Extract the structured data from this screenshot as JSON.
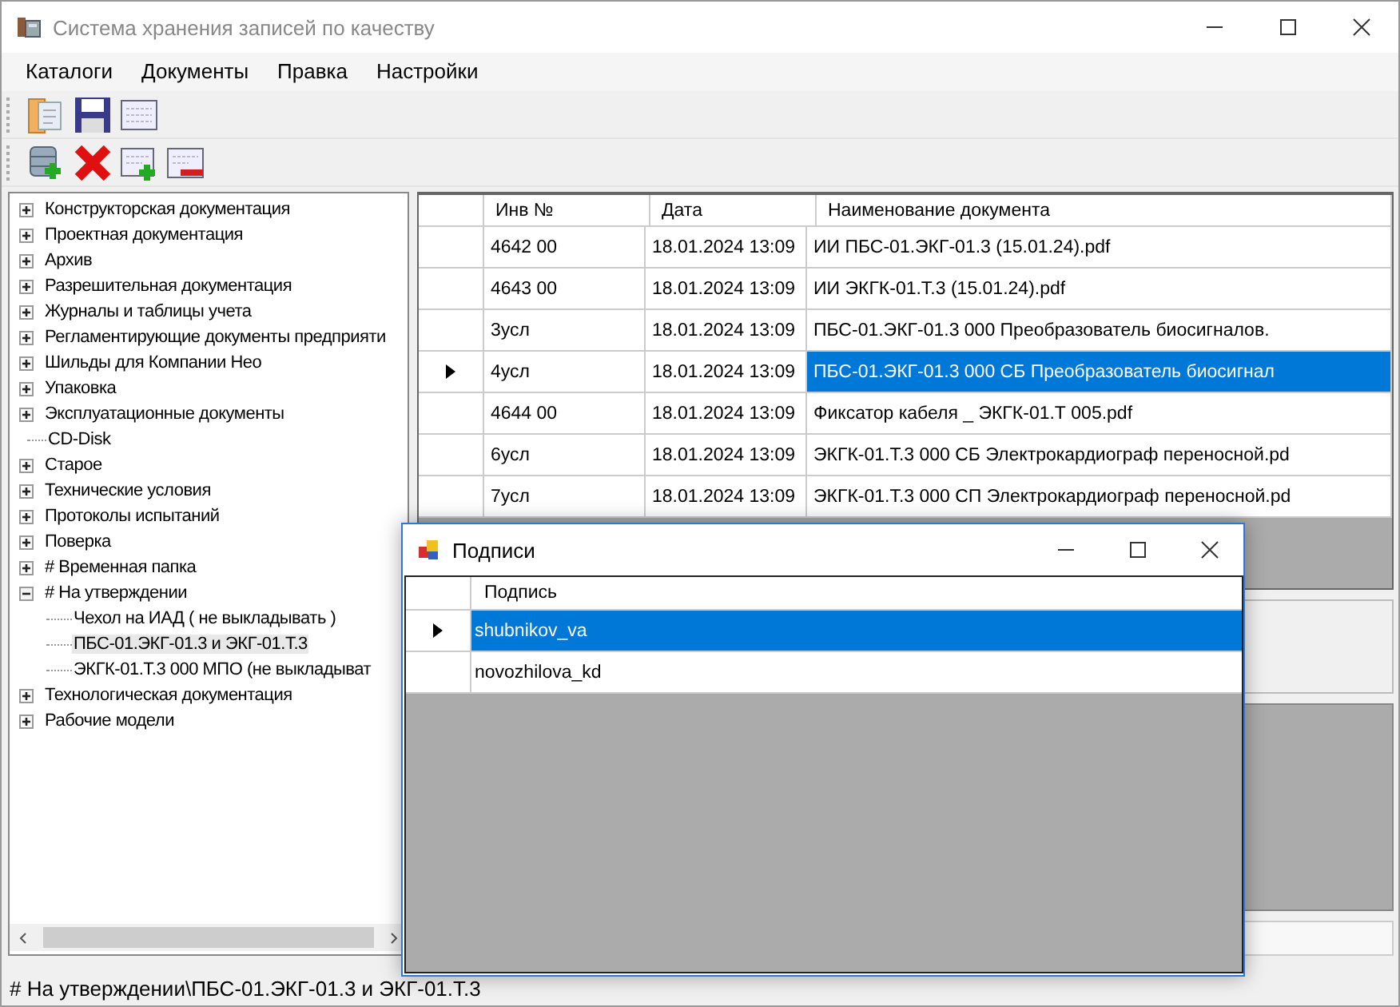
{
  "window": {
    "title": "Система хранения записей по качеству"
  },
  "menu": [
    "Каталоги",
    "Документы",
    "Правка",
    "Настройки"
  ],
  "tree": [
    {
      "label": "Конструкторская документация",
      "has_children": true,
      "expanded": false,
      "selected": false
    },
    {
      "label": "Проектная документация",
      "has_children": true,
      "expanded": false,
      "selected": false
    },
    {
      "label": "Архив",
      "has_children": true,
      "expanded": false,
      "selected": false
    },
    {
      "label": "Разрешительная документация",
      "has_children": true,
      "expanded": false,
      "selected": false
    },
    {
      "label": "Журналы и таблицы учета",
      "has_children": true,
      "expanded": false,
      "selected": false
    },
    {
      "label": "Регламентирующие документы предприяти",
      "has_children": true,
      "expanded": false,
      "selected": false
    },
    {
      "label": "Шильды для Компании Нео",
      "has_children": true,
      "expanded": false,
      "selected": false
    },
    {
      "label": "Упаковка",
      "has_children": true,
      "expanded": false,
      "selected": false
    },
    {
      "label": "Эксплуатационные документы",
      "has_children": true,
      "expanded": false,
      "selected": false
    },
    {
      "label": "CD-Disk",
      "has_children": false,
      "selected": false
    },
    {
      "label": "Старое",
      "has_children": true,
      "expanded": false,
      "selected": false
    },
    {
      "label": "Технические условия",
      "has_children": true,
      "expanded": false,
      "selected": false
    },
    {
      "label": "Протоколы испытаний",
      "has_children": true,
      "expanded": false,
      "selected": false
    },
    {
      "label": "Поверка",
      "has_children": true,
      "expanded": false,
      "selected": false
    },
    {
      "label": "# Временная папка",
      "has_children": true,
      "expanded": false,
      "selected": false
    },
    {
      "label": "# На утверждении",
      "has_children": true,
      "expanded": true,
      "selected": false,
      "children": [
        {
          "label": "Чехол на ИАД ( не выкладывать )",
          "has_children": false,
          "selected": false
        },
        {
          "label": "ПБС-01.ЭКГ-01.3  и ЭКГ-01.Т.3",
          "has_children": false,
          "selected": true
        },
        {
          "label": "ЭКГК-01.Т.3 000 МПО (не выкладыват",
          "has_children": false,
          "selected": false
        }
      ]
    },
    {
      "label": "Технологическая документация",
      "has_children": true,
      "expanded": false,
      "selected": false
    },
    {
      "label": "Рабочие модели",
      "has_children": true,
      "expanded": false,
      "selected": false
    }
  ],
  "table": {
    "columns": [
      "Инв №",
      "Дата",
      "Наименование документа"
    ],
    "rows": [
      {
        "cells": [
          "4642 00",
          "18.01.2024 13:09",
          "ИИ ПБС-01.ЭКГ-01.3 (15.01.24).pdf"
        ],
        "selected": false
      },
      {
        "cells": [
          "4643 00",
          "18.01.2024 13:09",
          "ИИ ЭКГК-01.Т.3 (15.01.24).pdf"
        ],
        "selected": false
      },
      {
        "cells": [
          "3усл",
          "18.01.2024 13:09",
          "ПБС-01.ЭКГ-01.3 000   Преобразователь биосигналов."
        ],
        "selected": false
      },
      {
        "cells": [
          "4усл",
          "18.01.2024 13:09",
          "ПБС-01.ЭКГ-01.3 000  СБ  Преобразователь биосигнал"
        ],
        "selected": true
      },
      {
        "cells": [
          "4644 00",
          "18.01.2024 13:09",
          "Фиксатор кабеля _ ЭКГК-01.Т 005.pdf"
        ],
        "selected": false
      },
      {
        "cells": [
          "6усл",
          "18.01.2024 13:09",
          "ЭКГК-01.Т.3 000 СБ Электрокардиограф переносной.pd"
        ],
        "selected": false
      },
      {
        "cells": [
          "7усл",
          "18.01.2024 13:09",
          "ЭКГК-01.Т.3 000 СП Электрокардиограф переносной.pd"
        ],
        "selected": false
      }
    ]
  },
  "status_bar": "# На утверждении\\ПБС-01.ЭКГ-01.3  и ЭКГ-01.Т.3",
  "dialog": {
    "title": "Подписи",
    "columns": [
      "Подпись"
    ],
    "rows": [
      {
        "cells": [
          "shubnikov_va"
        ],
        "selected": true
      },
      {
        "cells": [
          "novozhilova_kd"
        ],
        "selected": false
      }
    ]
  }
}
